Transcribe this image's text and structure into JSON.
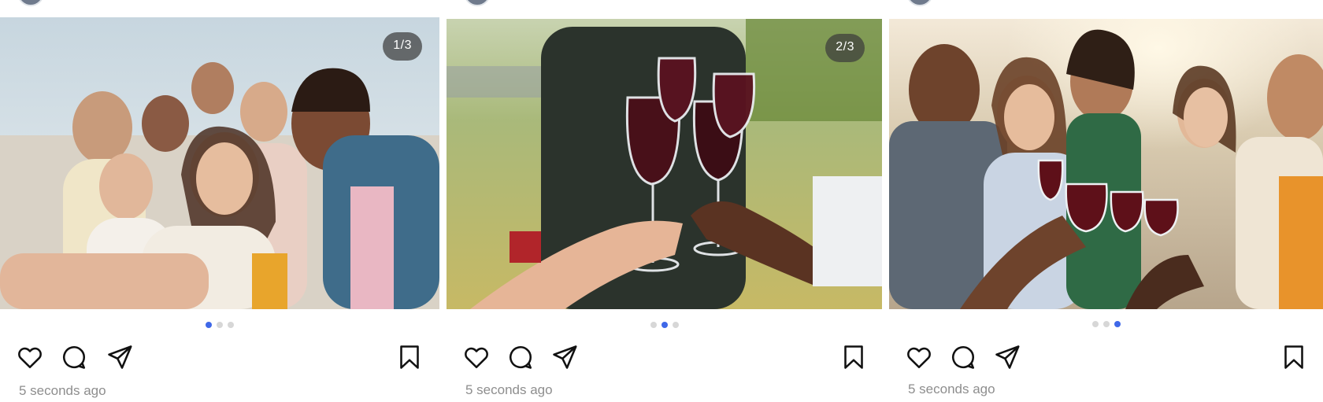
{
  "posts": [
    {
      "counter": "1/3",
      "dots": [
        true,
        false,
        false
      ],
      "timestamp": "5 seconds ago",
      "image_alt": "Group of friends taking a selfie outdoors"
    },
    {
      "counter": "2/3",
      "dots": [
        false,
        true,
        false
      ],
      "timestamp": "5 seconds ago",
      "image_alt": "Hands toasting glasses of red wine"
    },
    {
      "counter": "",
      "dots": [
        false,
        false,
        true
      ],
      "timestamp": "5 seconds ago",
      "image_alt": "Friends laughing and toasting red wine outdoors"
    }
  ],
  "icons": {
    "like": "heart-icon",
    "comment": "comment-icon",
    "share": "send-icon",
    "save": "bookmark-icon"
  },
  "colors": {
    "active_dot": "#3f68e8",
    "inactive_dot": "#d7d7d7",
    "timestamp": "#8e8e8e",
    "counter_bg": "#3c3c3c"
  }
}
